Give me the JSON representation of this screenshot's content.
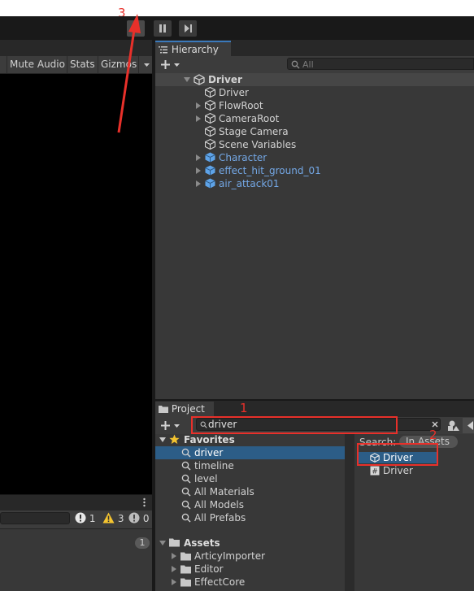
{
  "toolbar": {
    "play_icon": "play-icon",
    "pause_icon": "pause-icon",
    "step_icon": "step-icon"
  },
  "game_view": {
    "buttons": [
      "Mute Audio",
      "Stats",
      "Gizmos"
    ]
  },
  "console": {
    "info_count": "1",
    "warning_count": "3",
    "error_count": "0",
    "collapsed_count": "1"
  },
  "hierarchy": {
    "tab_label": "Hierarchy",
    "search_placeholder": "All",
    "root": "Driver",
    "items": [
      {
        "label": "Driver",
        "type": "gameobject",
        "expandable": false
      },
      {
        "label": "FlowRoot",
        "type": "gameobject",
        "expandable": true
      },
      {
        "label": "CameraRoot",
        "type": "gameobject",
        "expandable": true
      },
      {
        "label": "Stage Camera",
        "type": "gameobject",
        "expandable": false
      },
      {
        "label": "Scene Variables",
        "type": "gameobject",
        "expandable": false
      },
      {
        "label": "Character",
        "type": "prefab",
        "expandable": true
      },
      {
        "label": "effect_hit_ground_01",
        "type": "prefab",
        "expandable": true
      },
      {
        "label": "air_attack01",
        "type": "prefab",
        "expandable": true
      }
    ]
  },
  "project": {
    "tab_label": "Project",
    "search_value": "driver",
    "search_scope_label": "Search:",
    "search_scope_value": "In Assets",
    "favorites_label": "Favorites",
    "favorites": [
      "driver",
      "timeline",
      "level",
      "All Materials",
      "All Models",
      "All Prefabs"
    ],
    "assets_label": "Assets",
    "asset_folders": [
      "ArticyImporter",
      "Editor",
      "EffectCore"
    ],
    "results": [
      {
        "label": "Driver",
        "icon": "unity-scene-icon"
      },
      {
        "label": "Driver",
        "icon": "csharp-script-icon"
      }
    ]
  },
  "annotations": {
    "label_1": "1",
    "label_2": "2",
    "label_3": "3",
    "color": "#e8302a"
  }
}
